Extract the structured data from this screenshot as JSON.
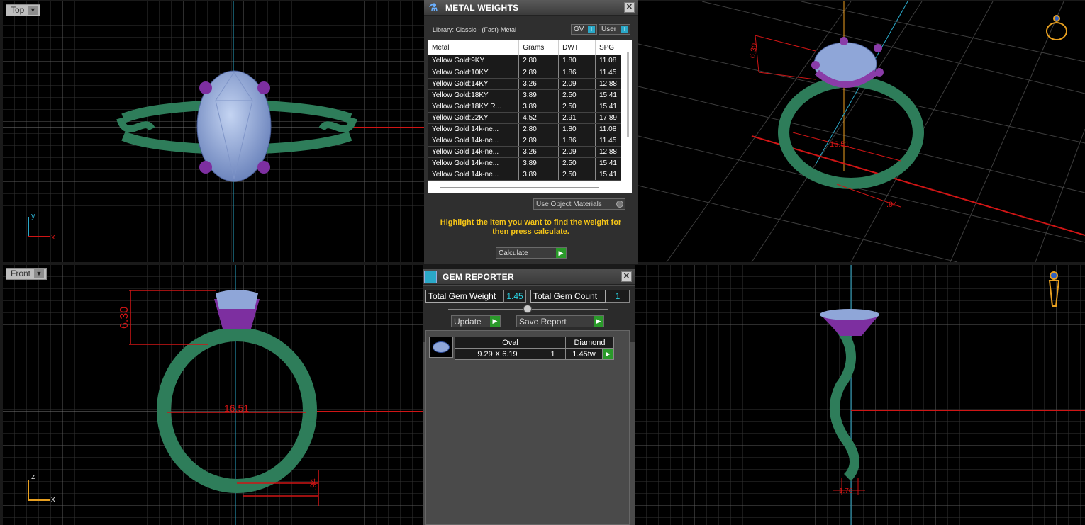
{
  "viewports": {
    "top": {
      "label": "Top",
      "axis_v": "y",
      "axis_h": "x"
    },
    "front": {
      "label": "Front",
      "axis_v": "z",
      "axis_h": "x"
    },
    "persp": {
      "dim_a": "6.30",
      "dim_b": "16.51",
      "dim_c": ".94"
    },
    "right": {
      "dim": "1.70"
    }
  },
  "front_dims": {
    "height": "6.30",
    "width": "16.51",
    "thickness": ".94"
  },
  "metal_weights": {
    "title": "METAL WEIGHTS",
    "library": "Library: Classic - (Fast)-Metal",
    "toggle_gv": "GV",
    "toggle_user": "User",
    "columns": [
      "Metal",
      "Grams",
      "DWT",
      "SPG"
    ],
    "rows": [
      [
        "Yellow Gold:9KY",
        "2.80",
        "1.80",
        "11.08"
      ],
      [
        "Yellow Gold:10KY",
        "2.89",
        "1.86",
        "11.45"
      ],
      [
        "Yellow Gold:14KY",
        "3.26",
        "2.09",
        "12.88"
      ],
      [
        "Yellow Gold:18KY",
        "3.89",
        "2.50",
        "15.41"
      ],
      [
        "Yellow Gold:18KY R...",
        "3.89",
        "2.50",
        "15.41"
      ],
      [
        "Yellow Gold:22KY",
        "4.52",
        "2.91",
        "17.89"
      ],
      [
        "Yellow Gold 14k-ne...",
        "2.80",
        "1.80",
        "11.08"
      ],
      [
        "Yellow Gold 14k-ne...",
        "2.89",
        "1.86",
        "11.45"
      ],
      [
        "Yellow Gold 14k-ne...",
        "3.26",
        "2.09",
        "12.88"
      ],
      [
        "Yellow Gold 14k-ne...",
        "3.89",
        "2.50",
        "15.41"
      ],
      [
        "Yellow Gold 14k-ne...",
        "3.89",
        "2.50",
        "15.41"
      ]
    ],
    "use_object_materials": "Use Object Materials",
    "hint": "Highlight the item you want to find the weight for then press calculate.",
    "calculate": "Calculate"
  },
  "gem_reporter": {
    "title": "GEM REPORTER",
    "total_weight_label": "Total Gem Weight",
    "total_weight": "1.45",
    "total_count_label": "Total Gem Count",
    "total_count": "1",
    "update": "Update",
    "save_report": "Save Report",
    "gem": {
      "shape": "Oval",
      "type": "Diamond",
      "size": "9.29 X 6.19",
      "count": "1",
      "weight": "1.45tw"
    }
  },
  "colors": {
    "band": "#2e7d5a",
    "prong": "#8a3ca8",
    "stone": "#8fa6d8",
    "dim": "#e01010",
    "axis": "#2aa8c8",
    "accent": "#f0c020"
  }
}
